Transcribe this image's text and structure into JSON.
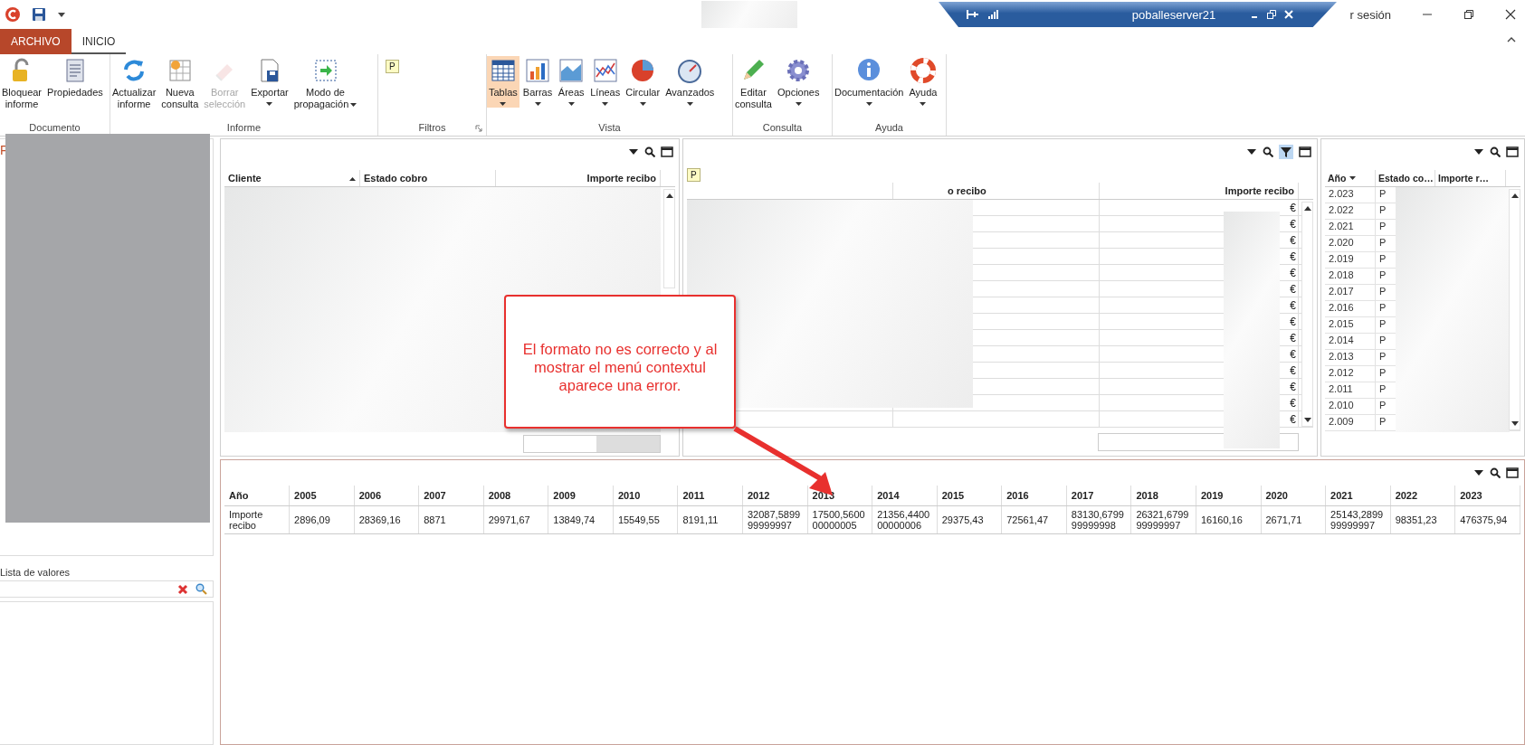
{
  "title_bar": {
    "account": "r sesión"
  },
  "remote_bar": {
    "title": "poballeserver21"
  },
  "tabs": [
    {
      "label": "ARCHIVO",
      "kind": "file",
      "selected": false
    },
    {
      "label": "INICIO",
      "kind": "tab",
      "selected": true
    }
  ],
  "ribbon_groups": [
    {
      "label": "Documento",
      "buttons": [
        {
          "lines": [
            "Bloquear",
            "informe"
          ],
          "dropdown": false,
          "disabled": false
        },
        {
          "lines": [
            "Propiedades"
          ],
          "dropdown": false,
          "disabled": false
        }
      ]
    },
    {
      "label": "Informe",
      "buttons": [
        {
          "lines": [
            "Actualizar",
            "informe"
          ],
          "dropdown": false,
          "disabled": false
        },
        {
          "lines": [
            "Nueva",
            "consulta"
          ],
          "dropdown": false,
          "disabled": false
        },
        {
          "lines": [
            "Borrar",
            "selección"
          ],
          "dropdown": false,
          "disabled": true
        },
        {
          "lines": [
            "Exportar"
          ],
          "dropdown": true,
          "disabled": false
        },
        {
          "lines": [
            "Modo de",
            "propagación"
          ],
          "dropdown": true,
          "disabled": false
        }
      ]
    },
    {
      "label": "Filtros",
      "badge": "P"
    },
    {
      "label": "Vista",
      "buttons": [
        {
          "lines": [
            "Tablas"
          ],
          "dropdown": true,
          "disabled": false,
          "selected": true
        },
        {
          "lines": [
            "Barras"
          ],
          "dropdown": true,
          "disabled": false,
          "selected": false
        },
        {
          "lines": [
            "Áreas"
          ],
          "dropdown": true,
          "disabled": false,
          "selected": false
        },
        {
          "lines": [
            "Líneas"
          ],
          "dropdown": true,
          "disabled": false,
          "selected": false
        },
        {
          "lines": [
            "Circular"
          ],
          "dropdown": true,
          "disabled": false,
          "selected": false
        },
        {
          "lines": [
            "Avanzados"
          ],
          "dropdown": true,
          "disabled": false,
          "selected": false
        }
      ]
    },
    {
      "label": "Consulta",
      "buttons": [
        {
          "lines": [
            "Editar",
            "consulta"
          ],
          "dropdown": false,
          "disabled": false
        },
        {
          "lines": [
            "Opciones"
          ],
          "dropdown": true,
          "disabled": false
        }
      ]
    },
    {
      "label": "Ayuda",
      "buttons": [
        {
          "lines": [
            "Documentación"
          ],
          "dropdown": true,
          "disabled": false
        },
        {
          "lines": [
            "Ayuda"
          ],
          "dropdown": true,
          "disabled": false
        }
      ]
    }
  ],
  "left_pane": {
    "title_fragment": "F",
    "list_label": "Lista de valores"
  },
  "panel_clients": {
    "columns": [
      {
        "label": "Cliente",
        "sorted_ascending": true
      },
      {
        "label": "Estado cobro",
        "sorted_ascending": false
      },
      {
        "label": "Importe recibo",
        "sorted_ascending": false
      }
    ]
  },
  "panel_receipts": {
    "filter_active": true,
    "badge": "P",
    "columns": [
      "o recibo",
      "Importe recibo"
    ],
    "rows": [
      "€",
      "€",
      "€",
      "€",
      "€",
      "€",
      "€",
      "€",
      "€",
      "€",
      "€",
      "€",
      "€",
      "€"
    ]
  },
  "panel_years": {
    "columns": [
      {
        "label": "Año",
        "sorted_descending": true
      },
      {
        "label": "Estado co…",
        "sorted_descending": false
      },
      {
        "label": "Importe r…",
        "sorted_descending": false
      }
    ],
    "rows": [
      {
        "year": "2.023",
        "status": "P"
      },
      {
        "year": "2.022",
        "status": "P"
      },
      {
        "year": "2.021",
        "status": "P"
      },
      {
        "year": "2.020",
        "status": "P"
      },
      {
        "year": "2.019",
        "status": "P"
      },
      {
        "year": "2.018",
        "status": "P"
      },
      {
        "year": "2.017",
        "status": "P"
      },
      {
        "year": "2.016",
        "status": "P"
      },
      {
        "year": "2.015",
        "status": "P"
      },
      {
        "year": "2.014",
        "status": "P"
      },
      {
        "year": "2.013",
        "status": "P"
      },
      {
        "year": "2.012",
        "status": "P"
      },
      {
        "year": "2.011",
        "status": "P"
      },
      {
        "year": "2.010",
        "status": "P"
      },
      {
        "year": "2.009",
        "status": "P"
      }
    ]
  },
  "pivot": {
    "header_label": "Año",
    "row_label": "Importe recibo",
    "years": [
      "2005",
      "2006",
      "2007",
      "2008",
      "2009",
      "2010",
      "2011",
      "2012",
      "2013",
      "2014",
      "2015",
      "2016",
      "2017",
      "2018",
      "2019",
      "2020",
      "2021",
      "2022",
      "2023"
    ],
    "values": [
      "2896,09",
      "28369,16",
      "8871",
      "29971,67",
      "13849,74",
      "15549,55",
      "8191,11",
      "32087,589999999997",
      "17500,560000000005",
      "21356,440000000006",
      "29375,43",
      "72561,47",
      "83130,679999999998",
      "26321,679999999997",
      "16160,16",
      "2671,71",
      "25143,289999999997",
      "98351,23",
      "476375,94"
    ]
  },
  "callout": {
    "text": "El formato no es correcto y al mostrar el menú contextul aparece una error."
  }
}
